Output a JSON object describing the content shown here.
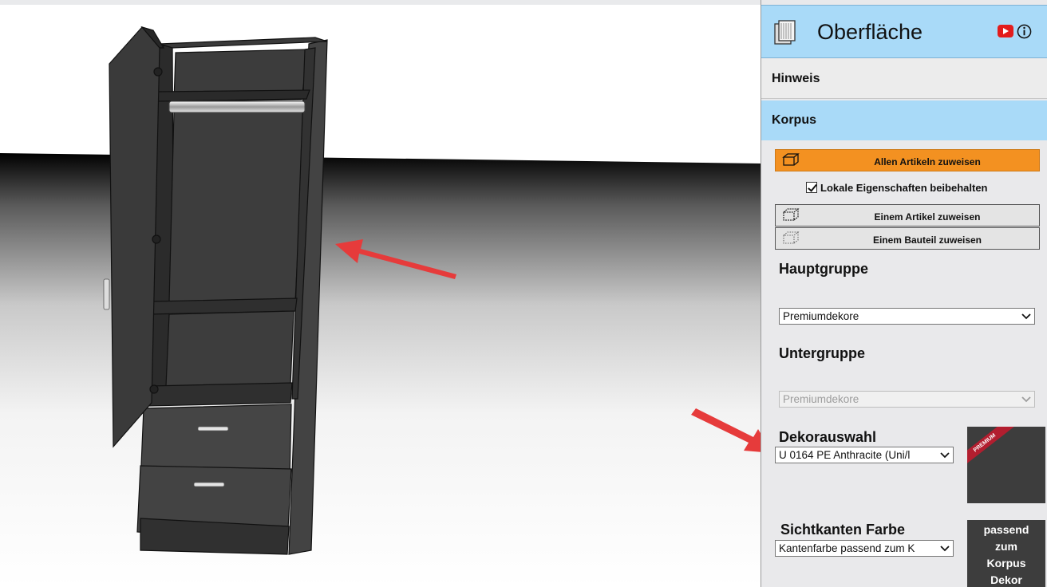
{
  "panel": {
    "title": "Oberfläche",
    "hint_section": "Hinweis",
    "korpus_section": "Korpus",
    "assign_all_label": "Allen Artikeln zuweisen",
    "keep_local_label": "Lokale Eigenschaften beibehalten",
    "keep_local_checked": true,
    "assign_article_label": "Einem Artikel zuweisen",
    "assign_part_label": "Einem Bauteil zuweisen",
    "main_group_label": "Hauptgruppe",
    "main_group_value": "Premiumdekore",
    "sub_group_label": "Untergruppe",
    "sub_group_value": "Premiumdekore",
    "decor_label": "Dekorauswahl",
    "decor_value": "U 0164 PE Anthracite (Uni/l",
    "decor_badge": "PREMIUM",
    "edge_color_label": "Sichtkanten Farbe",
    "edge_color_value": "Kantenfarbe passend zum K",
    "edge_tile_lines": [
      "passend",
      "zum",
      "Korpus",
      "Dekor"
    ],
    "icons": [
      "surface-texture-icon",
      "youtube-icon",
      "info-icon",
      "box-icon",
      "chevron-down-icon"
    ],
    "colors": {
      "header": "#a9daf8",
      "primary_button": "#f39121",
      "swatch": "#3d3d3d",
      "badge": "#b21e2f",
      "arrow": "#e63b3b"
    }
  }
}
